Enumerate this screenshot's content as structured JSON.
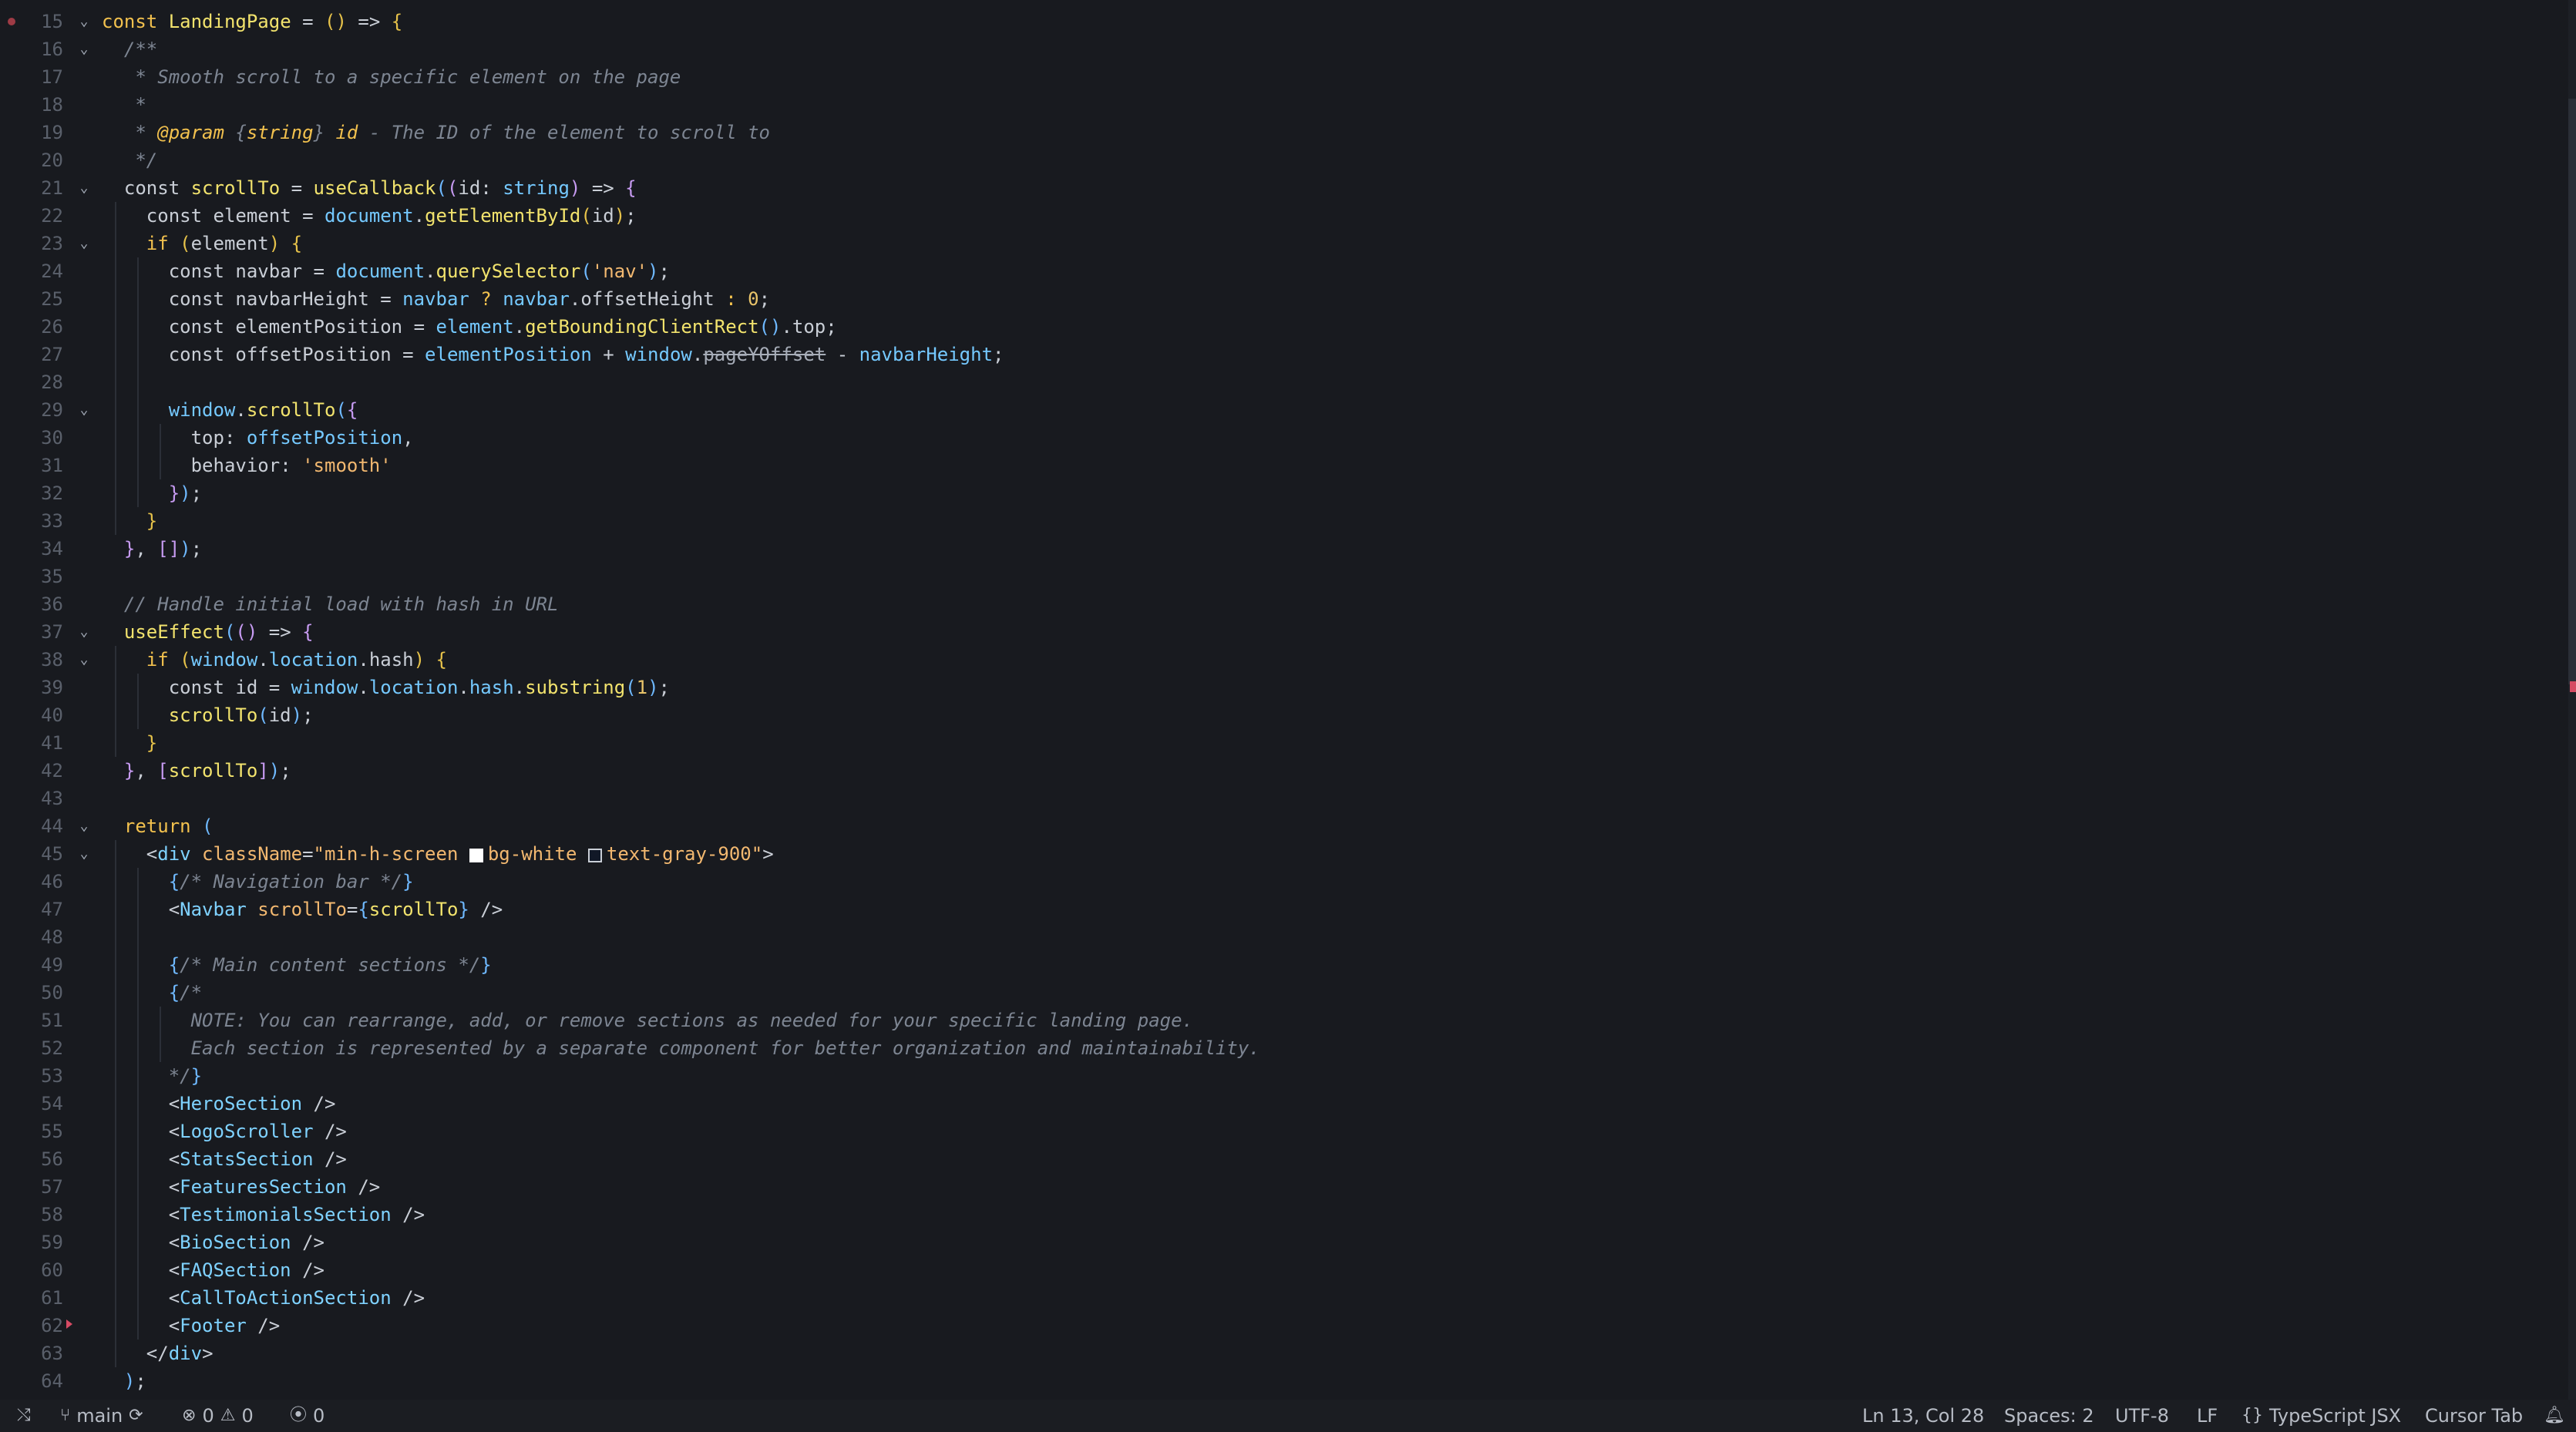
{
  "editor": {
    "breakpoint_line": 15,
    "deprecated_symbol": "pageYOffset",
    "lines": [
      {
        "n": "15",
        "fold": true,
        "mark": "dot",
        "indent": 0,
        "tokens": [
          [
            "kw",
            "const "
          ],
          [
            "def",
            "LandingPage"
          ],
          [
            "punc",
            " = "
          ],
          [
            "br1",
            "() "
          ],
          [
            "punc",
            "=> "
          ],
          [
            "br1",
            "{"
          ]
        ]
      },
      {
        "n": "16",
        "fold": true,
        "indent": 1,
        "tokens": [
          [
            "cm",
            "/**"
          ]
        ]
      },
      {
        "n": "17",
        "fold": false,
        "indent": 1,
        "tokens": [
          [
            "cm",
            " * Smooth scroll to a specific element on the page"
          ]
        ]
      },
      {
        "n": "18",
        "fold": false,
        "indent": 1,
        "tokens": [
          [
            "cm",
            " *"
          ]
        ]
      },
      {
        "n": "19",
        "fold": false,
        "indent": 1,
        "tokens": [
          [
            "cm",
            " * "
          ],
          [
            "cm-em",
            "@param "
          ],
          [
            "cm",
            "{"
          ],
          [
            "cm-em",
            "string"
          ],
          [
            "cm",
            "} "
          ],
          [
            "cm-em",
            "id"
          ],
          [
            "cm",
            " - The ID of the element to scroll to"
          ]
        ]
      },
      {
        "n": "20",
        "fold": false,
        "indent": 1,
        "tokens": [
          [
            "cm",
            " */"
          ]
        ]
      },
      {
        "n": "21",
        "fold": true,
        "indent": 1,
        "tokens": [
          [
            "kw2",
            "const "
          ],
          [
            "def",
            "scrollTo"
          ],
          [
            "punc",
            " = "
          ],
          [
            "call",
            "useCallback"
          ],
          [
            "br2",
            "("
          ],
          [
            "br3",
            "("
          ],
          [
            "var",
            "id"
          ],
          [
            "punc",
            ": "
          ],
          [
            "prop",
            "string"
          ],
          [
            "br3",
            ")"
          ],
          [
            "punc",
            " => "
          ],
          [
            "br3",
            "{"
          ]
        ]
      },
      {
        "n": "22",
        "fold": false,
        "indent": 2,
        "tokens": [
          [
            "kw2",
            "const "
          ],
          [
            "var",
            "element"
          ],
          [
            "punc",
            " = "
          ],
          [
            "prop",
            "document"
          ],
          [
            "punc",
            "."
          ],
          [
            "call",
            "getElementById"
          ],
          [
            "br1",
            "("
          ],
          [
            "var",
            "id"
          ],
          [
            "br1",
            ")"
          ],
          [
            "punc",
            ";"
          ]
        ]
      },
      {
        "n": "23",
        "fold": true,
        "indent": 2,
        "tokens": [
          [
            "kw",
            "if "
          ],
          [
            "br1",
            "("
          ],
          [
            "var",
            "element"
          ],
          [
            "br1",
            ") "
          ],
          [
            "br1",
            "{"
          ]
        ]
      },
      {
        "n": "24",
        "fold": false,
        "indent": 3,
        "tokens": [
          [
            "kw2",
            "const "
          ],
          [
            "var",
            "navbar"
          ],
          [
            "punc",
            " = "
          ],
          [
            "prop",
            "document"
          ],
          [
            "punc",
            "."
          ],
          [
            "call",
            "querySelector"
          ],
          [
            "br2",
            "("
          ],
          [
            "str",
            "'nav'"
          ],
          [
            "br2",
            ")"
          ],
          [
            "punc",
            ";"
          ]
        ]
      },
      {
        "n": "25",
        "fold": false,
        "indent": 3,
        "tokens": [
          [
            "kw2",
            "const "
          ],
          [
            "var",
            "navbarHeight"
          ],
          [
            "punc",
            " = "
          ],
          [
            "prop",
            "navbar"
          ],
          [
            "kw",
            " ? "
          ],
          [
            "prop",
            "navbar"
          ],
          [
            "punc",
            "."
          ],
          [
            "var",
            "offsetHeight"
          ],
          [
            "kw",
            " : "
          ],
          [
            "num",
            "0"
          ],
          [
            "punc",
            ";"
          ]
        ]
      },
      {
        "n": "26",
        "fold": false,
        "indent": 3,
        "tokens": [
          [
            "kw2",
            "const "
          ],
          [
            "var",
            "elementPosition"
          ],
          [
            "punc",
            " = "
          ],
          [
            "prop",
            "element"
          ],
          [
            "punc",
            "."
          ],
          [
            "call",
            "getBoundingClientRect"
          ],
          [
            "br2",
            "()"
          ],
          [
            "punc",
            "."
          ],
          [
            "var",
            "top"
          ],
          [
            "punc",
            ";"
          ]
        ]
      },
      {
        "n": "27",
        "fold": false,
        "indent": 3,
        "tokens": [
          [
            "kw2",
            "const "
          ],
          [
            "var",
            "offsetPosition"
          ],
          [
            "punc",
            " = "
          ],
          [
            "prop",
            "elementPosition"
          ],
          [
            "punc",
            " + "
          ],
          [
            "prop",
            "window"
          ],
          [
            "punc",
            "."
          ],
          [
            "dep",
            "pageYOffset"
          ],
          [
            "punc",
            " - "
          ],
          [
            "prop",
            "navbarHeight"
          ],
          [
            "punc",
            ";"
          ]
        ]
      },
      {
        "n": "28",
        "fold": false,
        "indent": 3,
        "tokens": []
      },
      {
        "n": "29",
        "fold": true,
        "indent": 3,
        "tokens": [
          [
            "prop",
            "window"
          ],
          [
            "punc",
            "."
          ],
          [
            "call",
            "scrollTo"
          ],
          [
            "br2",
            "("
          ],
          [
            "br3",
            "{"
          ]
        ]
      },
      {
        "n": "30",
        "fold": false,
        "indent": 4,
        "tokens": [
          [
            "var",
            "top"
          ],
          [
            "punc",
            ": "
          ],
          [
            "prop",
            "offsetPosition"
          ],
          [
            "punc",
            ","
          ]
        ]
      },
      {
        "n": "31",
        "fold": false,
        "indent": 4,
        "tokens": [
          [
            "var",
            "behavior"
          ],
          [
            "punc",
            ": "
          ],
          [
            "str",
            "'smooth'"
          ]
        ]
      },
      {
        "n": "32",
        "fold": false,
        "indent": 3,
        "tokens": [
          [
            "br3",
            "}"
          ],
          [
            "br2",
            ")"
          ],
          [
            "punc",
            ";"
          ]
        ]
      },
      {
        "n": "33",
        "fold": false,
        "indent": 2,
        "tokens": [
          [
            "br1",
            "}"
          ]
        ]
      },
      {
        "n": "34",
        "fold": false,
        "indent": 1,
        "tokens": [
          [
            "br3",
            "}"
          ],
          [
            "punc",
            ", "
          ],
          [
            "br3",
            "[]"
          ],
          [
            "br2",
            ")"
          ],
          [
            "punc",
            ";"
          ]
        ]
      },
      {
        "n": "35",
        "fold": false,
        "indent": 1,
        "tokens": []
      },
      {
        "n": "36",
        "fold": false,
        "indent": 1,
        "tokens": [
          [
            "cm",
            "// Handle initial load with hash in URL"
          ]
        ]
      },
      {
        "n": "37",
        "fold": true,
        "indent": 1,
        "tokens": [
          [
            "call",
            "useEffect"
          ],
          [
            "br2",
            "("
          ],
          [
            "br3",
            "() "
          ],
          [
            "punc",
            "=> "
          ],
          [
            "br3",
            "{"
          ]
        ]
      },
      {
        "n": "38",
        "fold": true,
        "indent": 2,
        "tokens": [
          [
            "kw",
            "if "
          ],
          [
            "br1",
            "("
          ],
          [
            "prop",
            "window"
          ],
          [
            "punc",
            "."
          ],
          [
            "prop",
            "location"
          ],
          [
            "punc",
            "."
          ],
          [
            "var",
            "hash"
          ],
          [
            "br1",
            ") "
          ],
          [
            "br1",
            "{"
          ]
        ]
      },
      {
        "n": "39",
        "fold": false,
        "indent": 3,
        "tokens": [
          [
            "kw2",
            "const "
          ],
          [
            "var",
            "id"
          ],
          [
            "punc",
            " = "
          ],
          [
            "prop",
            "window"
          ],
          [
            "punc",
            "."
          ],
          [
            "prop",
            "location"
          ],
          [
            "punc",
            "."
          ],
          [
            "prop",
            "hash"
          ],
          [
            "punc",
            "."
          ],
          [
            "call",
            "substring"
          ],
          [
            "br2",
            "("
          ],
          [
            "num",
            "1"
          ],
          [
            "br2",
            ")"
          ],
          [
            "punc",
            ";"
          ]
        ]
      },
      {
        "n": "40",
        "fold": false,
        "indent": 3,
        "tokens": [
          [
            "call",
            "scrollTo"
          ],
          [
            "br2",
            "("
          ],
          [
            "var",
            "id"
          ],
          [
            "br2",
            ")"
          ],
          [
            "punc",
            ";"
          ]
        ]
      },
      {
        "n": "41",
        "fold": false,
        "indent": 2,
        "tokens": [
          [
            "br1",
            "}"
          ]
        ]
      },
      {
        "n": "42",
        "fold": false,
        "indent": 1,
        "tokens": [
          [
            "br3",
            "}"
          ],
          [
            "punc",
            ", "
          ],
          [
            "br3",
            "["
          ],
          [
            "call",
            "scrollTo"
          ],
          [
            "br3",
            "]"
          ],
          [
            "br2",
            ")"
          ],
          [
            "punc",
            ";"
          ]
        ]
      },
      {
        "n": "43",
        "fold": false,
        "indent": 1,
        "tokens": []
      },
      {
        "n": "44",
        "fold": true,
        "indent": 1,
        "tokens": [
          [
            "kw",
            "return "
          ],
          [
            "br2",
            "("
          ]
        ]
      },
      {
        "n": "45",
        "fold": true,
        "indent": 2,
        "tokens": [
          [
            "punc",
            "<"
          ],
          [
            "tag",
            "div "
          ],
          [
            "attr",
            "className"
          ],
          [
            "punc",
            "="
          ],
          [
            "str",
            "\"min-h-screen "
          ],
          [
            "swatch",
            "white"
          ],
          [
            "str",
            "bg-white "
          ],
          [
            "swatch",
            "dark"
          ],
          [
            "str",
            "text-gray-900\""
          ],
          [
            "punc",
            ">"
          ]
        ]
      },
      {
        "n": "46",
        "fold": false,
        "indent": 3,
        "tokens": [
          [
            "br2",
            "{"
          ],
          [
            "cm",
            "/* Navigation bar */"
          ],
          [
            "br2",
            "}"
          ]
        ]
      },
      {
        "n": "47",
        "fold": false,
        "indent": 3,
        "tokens": [
          [
            "punc",
            "<"
          ],
          [
            "tag",
            "Navbar "
          ],
          [
            "attr",
            "scrollTo"
          ],
          [
            "punc",
            "="
          ],
          [
            "br2",
            "{"
          ],
          [
            "call",
            "scrollTo"
          ],
          [
            "br2",
            "}"
          ],
          [
            "punc",
            " />"
          ]
        ]
      },
      {
        "n": "48",
        "fold": false,
        "indent": 3,
        "tokens": []
      },
      {
        "n": "49",
        "fold": false,
        "indent": 3,
        "tokens": [
          [
            "br2",
            "{"
          ],
          [
            "cm",
            "/* Main content sections */"
          ],
          [
            "br2",
            "}"
          ]
        ]
      },
      {
        "n": "50",
        "fold": false,
        "indent": 3,
        "tokens": [
          [
            "br2",
            "{"
          ],
          [
            "cm",
            "/*"
          ]
        ]
      },
      {
        "n": "51",
        "fold": false,
        "indent": 4,
        "tokens": [
          [
            "cm",
            "NOTE: You can rearrange, add, or remove sections as needed for your specific landing page."
          ]
        ]
      },
      {
        "n": "52",
        "fold": false,
        "indent": 4,
        "tokens": [
          [
            "cm",
            "Each section is represented by a separate component for better organization and maintainability."
          ]
        ]
      },
      {
        "n": "53",
        "fold": false,
        "indent": 3,
        "tokens": [
          [
            "cm",
            "*/"
          ],
          [
            "br2",
            "}"
          ]
        ]
      },
      {
        "n": "54",
        "fold": false,
        "indent": 3,
        "tokens": [
          [
            "punc",
            "<"
          ],
          [
            "tag",
            "HeroSection"
          ],
          [
            "punc",
            " />"
          ]
        ]
      },
      {
        "n": "55",
        "fold": false,
        "indent": 3,
        "tokens": [
          [
            "punc",
            "<"
          ],
          [
            "tag",
            "LogoScroller"
          ],
          [
            "punc",
            " />"
          ]
        ]
      },
      {
        "n": "56",
        "fold": false,
        "indent": 3,
        "tokens": [
          [
            "punc",
            "<"
          ],
          [
            "tag",
            "StatsSection"
          ],
          [
            "punc",
            " />"
          ]
        ]
      },
      {
        "n": "57",
        "fold": false,
        "indent": 3,
        "tokens": [
          [
            "punc",
            "<"
          ],
          [
            "tag",
            "FeaturesSection"
          ],
          [
            "punc",
            " />"
          ]
        ]
      },
      {
        "n": "58",
        "fold": false,
        "indent": 3,
        "tokens": [
          [
            "punc",
            "<"
          ],
          [
            "tag",
            "TestimonialsSection"
          ],
          [
            "punc",
            " />"
          ]
        ]
      },
      {
        "n": "59",
        "fold": false,
        "indent": 3,
        "tokens": [
          [
            "punc",
            "<"
          ],
          [
            "tag",
            "BioSection"
          ],
          [
            "punc",
            " />"
          ]
        ]
      },
      {
        "n": "60",
        "fold": false,
        "indent": 3,
        "tokens": [
          [
            "punc",
            "<"
          ],
          [
            "tag",
            "FAQSection"
          ],
          [
            "punc",
            " />"
          ]
        ]
      },
      {
        "n": "61",
        "fold": false,
        "indent": 3,
        "tokens": [
          [
            "punc",
            "<"
          ],
          [
            "tag",
            "CallToActionSection"
          ],
          [
            "punc",
            " />"
          ]
        ]
      },
      {
        "n": "62",
        "fold": false,
        "mark": "tri",
        "indent": 3,
        "tokens": [
          [
            "punc",
            "<"
          ],
          [
            "tag",
            "Footer"
          ],
          [
            "punc",
            " />"
          ]
        ]
      },
      {
        "n": "63",
        "fold": false,
        "indent": 2,
        "tokens": [
          [
            "punc",
            "</"
          ],
          [
            "tag",
            "div"
          ],
          [
            "punc",
            ">"
          ]
        ]
      },
      {
        "n": "64",
        "fold": false,
        "indent": 1,
        "tokens": [
          [
            "br2",
            ")"
          ],
          [
            "punc",
            ";"
          ]
        ]
      }
    ]
  },
  "statusbar": {
    "branch": "main",
    "errors": "0",
    "warnings": "0",
    "ports": "0",
    "cursor": "Ln 13, Col 28",
    "spaces": "Spaces: 2",
    "encoding": "UTF-8",
    "eol": "LF",
    "language": "TypeScript JSX",
    "tab_mode": "Cursor Tab"
  },
  "colors": {
    "background": "#181a1f",
    "statusbar": "#1b1d22",
    "keyword": "#f2c14e",
    "property": "#75c9ff",
    "string": "#f2b870",
    "comment": "#7d8592",
    "error_marker": "#d64b64"
  }
}
